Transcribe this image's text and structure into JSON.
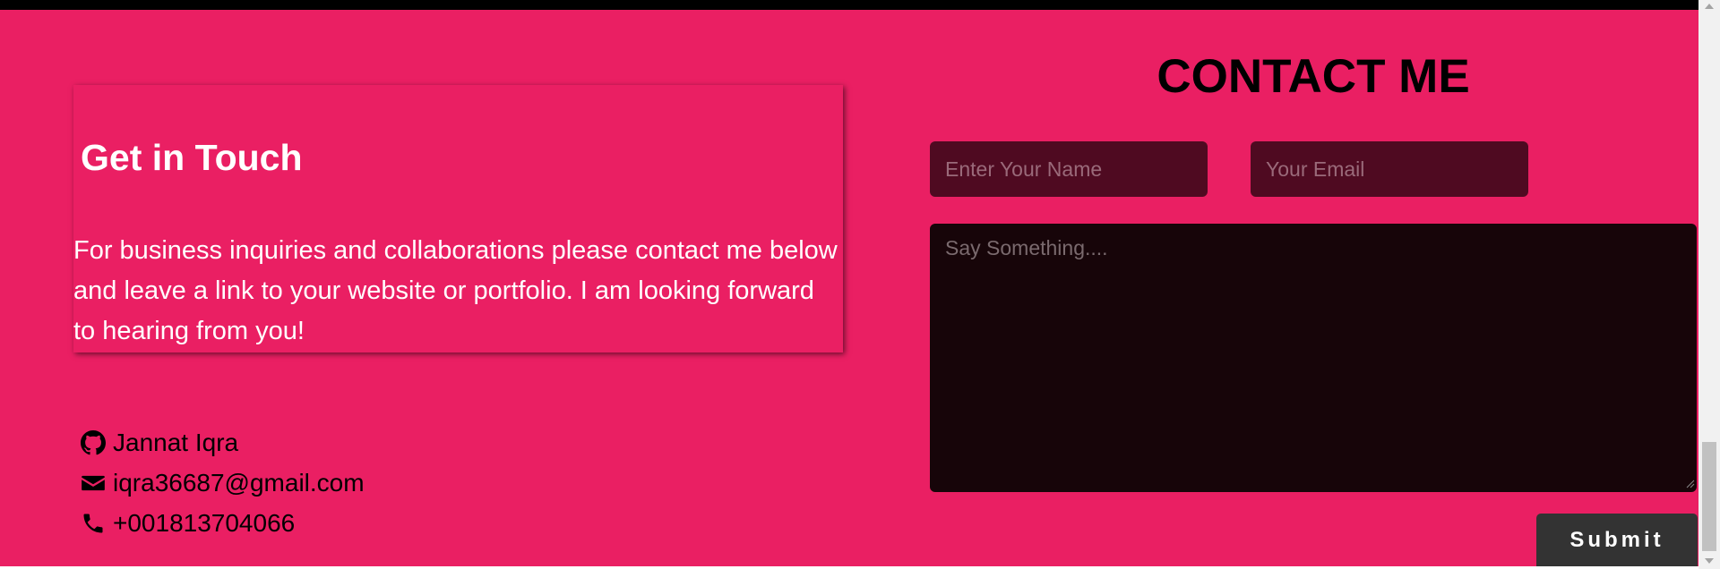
{
  "info": {
    "heading": "Get in Touch",
    "text": "For business inquiries and collaborations please contact me below and leave a link to your website or portfolio. I am looking forward to hearing from you!"
  },
  "contacts": [
    {
      "icon": "github-icon",
      "label": "Jannat Iqra"
    },
    {
      "icon": "envelope-icon",
      "label": "iqra36687@gmail.com"
    },
    {
      "icon": "phone-icon",
      "label": "+001813704066"
    }
  ],
  "form": {
    "title": "CONTACT ME",
    "name_placeholder": "Enter Your Name",
    "name_value": "",
    "email_placeholder": "Your Email",
    "email_value": "",
    "message_placeholder": "Say Something....",
    "message_value": "",
    "submit_label": "Submit"
  },
  "colors": {
    "section_bg": "#ea1f63",
    "top_bar": "#000000",
    "input_bg": "#4f0a21",
    "textarea_bg": "#170509",
    "button_bg": "#333333"
  }
}
